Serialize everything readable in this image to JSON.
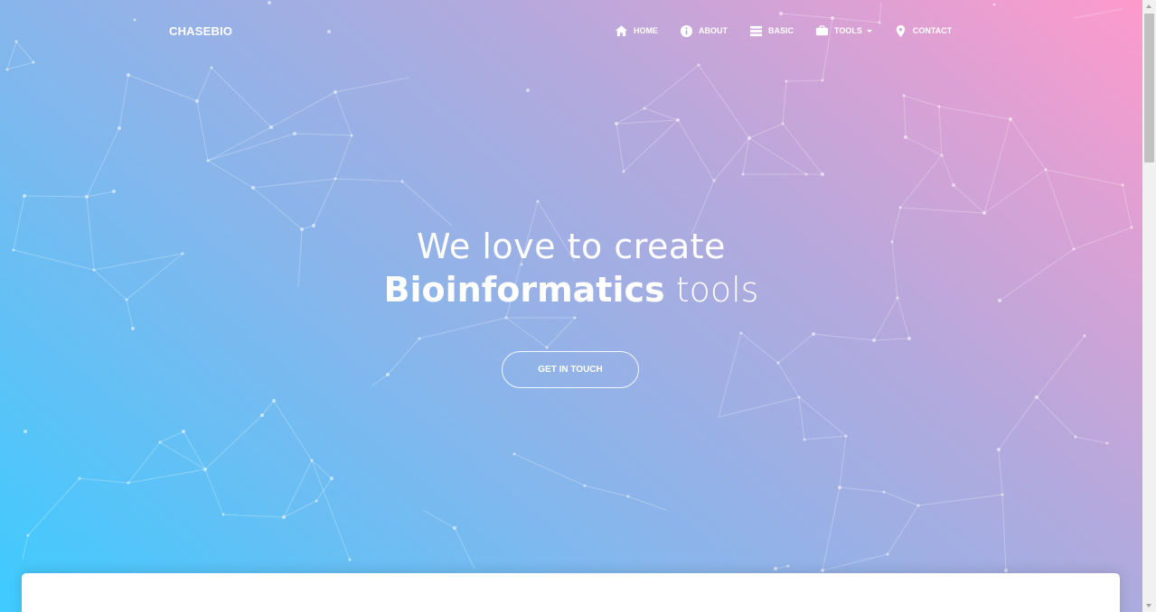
{
  "brand": "CHASEBIO",
  "nav": [
    {
      "label": "HOME",
      "icon": "home-icon"
    },
    {
      "label": "ABOUT",
      "icon": "info-icon"
    },
    {
      "label": "BASIC",
      "icon": "list-icon"
    },
    {
      "label": "TOOLS",
      "icon": "toolbox-icon",
      "dropdown": true
    },
    {
      "label": "CONTACT",
      "icon": "location-pin-icon"
    }
  ],
  "hero": {
    "line1": "We love to create",
    "line2_bold": "Bioinformatics",
    "line2_rest": " tools",
    "cta": "GET IN TOUCH"
  },
  "colors": {
    "gradient_start": "#3ecbff",
    "gradient_mid": "#b3a9dd",
    "gradient_end": "#fe9acc"
  }
}
